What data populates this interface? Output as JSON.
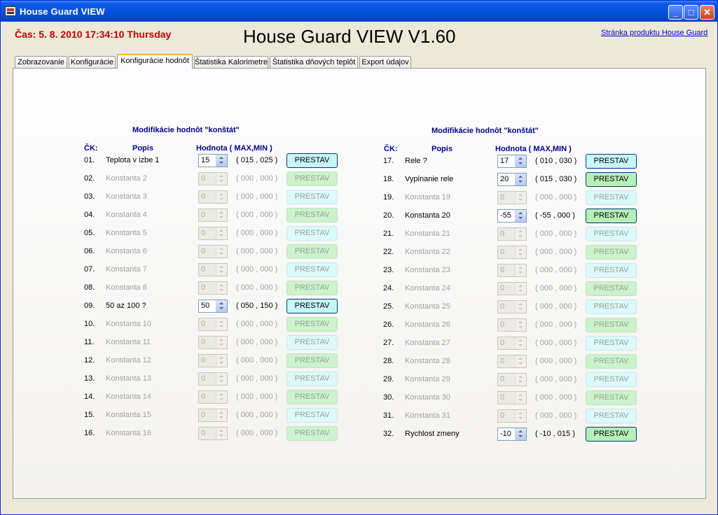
{
  "window": {
    "title": "House Guard VIEW",
    "min_label": "_",
    "max_label": "□",
    "close_label": "✕"
  },
  "header": {
    "clock": "Čas: 5. 8. 2010 17:34:10 Thursday",
    "app_heading": "House Guard VIEW V1.60",
    "product_link": "Stránka produktu House Guard"
  },
  "tabs": [
    {
      "label": "Zobrazovanie",
      "active": false
    },
    {
      "label": "Konfigurácie",
      "active": false
    },
    {
      "label": "Konfigurácie hodnôt",
      "active": true
    },
    {
      "label": "Štatistika Kalorimetre",
      "active": false
    },
    {
      "label": "Štatistika dňových teplôt",
      "active": false
    },
    {
      "label": "Export údajov",
      "active": false
    }
  ],
  "section_title": "Modifikácie hodnôt \"konštát\"",
  "columns": {
    "ck": "ČK:",
    "popis": "Popis",
    "hodnota": "Hodnota ( MAX,MIN )"
  },
  "button_label": "PRESTAV",
  "constants_left": [
    {
      "num": "01.",
      "desc": "Teplota v izbe 1",
      "value": "15",
      "range": "( 015 , 025 )",
      "enabled": true
    },
    {
      "num": "02.",
      "desc": "Konstanta 2",
      "value": "0",
      "range": "( 000 , 000 )",
      "enabled": false
    },
    {
      "num": "03.",
      "desc": "Konstanta 3",
      "value": "0",
      "range": "( 000 , 000 )",
      "enabled": false
    },
    {
      "num": "04.",
      "desc": "Konstanta 4",
      "value": "0",
      "range": "( 000 , 000 )",
      "enabled": false
    },
    {
      "num": "05.",
      "desc": "Konstanta 5",
      "value": "0",
      "range": "( 000 , 000 )",
      "enabled": false
    },
    {
      "num": "06.",
      "desc": "Konstanta 6",
      "value": "0",
      "range": "( 000 , 000 )",
      "enabled": false
    },
    {
      "num": "07.",
      "desc": "Konstanta 7",
      "value": "0",
      "range": "( 000 , 000 )",
      "enabled": false
    },
    {
      "num": "08.",
      "desc": "Konstanta 8",
      "value": "0",
      "range": "( 000 , 000 )",
      "enabled": false
    },
    {
      "num": "09.",
      "desc": "50 az 100 ?",
      "value": "50",
      "range": "( 050 , 150 )",
      "enabled": true
    },
    {
      "num": "10.",
      "desc": "Konstanta 10",
      "value": "0",
      "range": "( 000 , 000 )",
      "enabled": false
    },
    {
      "num": "11.",
      "desc": "Konstanta 11",
      "value": "0",
      "range": "( 000 , 000 )",
      "enabled": false
    },
    {
      "num": "12.",
      "desc": "Konstanta 12",
      "value": "0",
      "range": "( 000 , 000 )",
      "enabled": false
    },
    {
      "num": "13.",
      "desc": "Konstanta 13",
      "value": "0",
      "range": "( 000 , 000 )",
      "enabled": false
    },
    {
      "num": "14.",
      "desc": "Konstanta 14",
      "value": "0",
      "range": "( 000 , 000 )",
      "enabled": false
    },
    {
      "num": "15.",
      "desc": "Konstanta 15",
      "value": "0",
      "range": "( 000 , 000 )",
      "enabled": false
    },
    {
      "num": "16.",
      "desc": "Konstanta 16",
      "value": "0",
      "range": "( 000 , 000 )",
      "enabled": false
    }
  ],
  "constants_right": [
    {
      "num": "17.",
      "desc": "Rele ?",
      "value": "17",
      "range": "( 010 , 030 )",
      "enabled": true
    },
    {
      "num": "18.",
      "desc": "Vypinanie rele",
      "value": "20",
      "range": "( 015 , 030 )",
      "enabled": true
    },
    {
      "num": "19.",
      "desc": "Konstanta 19",
      "value": "0",
      "range": "( 000 , 000 )",
      "enabled": false
    },
    {
      "num": "20.",
      "desc": "Konstanta 20",
      "value": "-55",
      "range": "( -55 , 000 )",
      "enabled": true
    },
    {
      "num": "21.",
      "desc": "Konstanta 21",
      "value": "0",
      "range": "( 000 , 000 )",
      "enabled": false
    },
    {
      "num": "22.",
      "desc": "Konstanta 22",
      "value": "0",
      "range": "( 000 , 000 )",
      "enabled": false
    },
    {
      "num": "23.",
      "desc": "Konstanta 23",
      "value": "0",
      "range": "( 000 , 000 )",
      "enabled": false
    },
    {
      "num": "24.",
      "desc": "Konstanta 24",
      "value": "0",
      "range": "( 000 , 000 )",
      "enabled": false
    },
    {
      "num": "25.",
      "desc": "Konstanta 25",
      "value": "0",
      "range": "( 000 , 000 )",
      "enabled": false
    },
    {
      "num": "26.",
      "desc": "Konstanta 26",
      "value": "0",
      "range": "( 000 , 000 )",
      "enabled": false
    },
    {
      "num": "27.",
      "desc": "Konstanta 27",
      "value": "0",
      "range": "( 000 , 000 )",
      "enabled": false
    },
    {
      "num": "28.",
      "desc": "Konstanta 28",
      "value": "0",
      "range": "( 000 , 000 )",
      "enabled": false
    },
    {
      "num": "29.",
      "desc": "Konstanta 29",
      "value": "0",
      "range": "( 000 , 000 )",
      "enabled": false
    },
    {
      "num": "30.",
      "desc": "Konstanta 30",
      "value": "0",
      "range": "( 000 , 000 )",
      "enabled": false
    },
    {
      "num": "31.",
      "desc": "Konstanta 31",
      "value": "0",
      "range": "( 000 , 000 )",
      "enabled": false
    },
    {
      "num": "32.",
      "desc": "Rychlost zmeny",
      "value": "-10",
      "range": "( -10 , 015 )",
      "enabled": true
    }
  ],
  "colors": {
    "clock_red": "#c00000",
    "header_blue": "#00008b",
    "button_cyan": "#c6f6f8",
    "button_green": "#b6efb8",
    "titlebar_blue": "#0550d8"
  }
}
